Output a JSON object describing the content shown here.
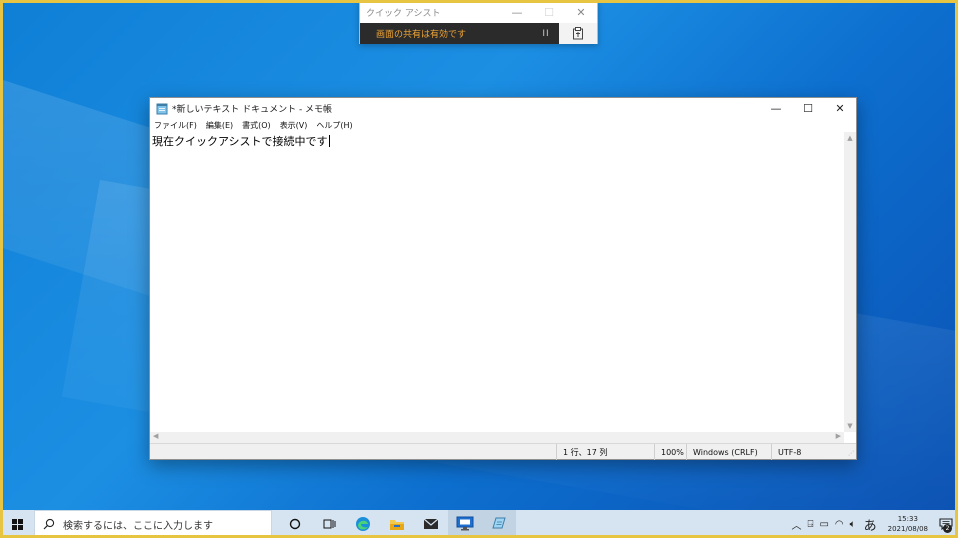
{
  "quick_assist": {
    "title": "クイック アシスト",
    "status": "画面の共有は有効です",
    "pause_label": "II"
  },
  "notepad": {
    "title": "*新しいテキスト ドキュメント - メモ帳",
    "menu": [
      "ファイル(F)",
      "編集(E)",
      "書式(O)",
      "表示(V)",
      "ヘルプ(H)"
    ],
    "content": "現在クイックアシストで接続中です",
    "status": {
      "position": "1 行、17 列",
      "zoom": "100%",
      "line_ending": "Windows (CRLF)",
      "encoding": "UTF-8"
    }
  },
  "taskbar": {
    "search_placeholder": "検索するには、ここに入力します",
    "ime": "あ",
    "time": "15:33",
    "date": "2021/08/08",
    "notification_count": "2"
  },
  "colors": {
    "accent_orange": "#f0a535",
    "frame_yellow": "#e8c443",
    "taskbar": "#d6e4f2"
  }
}
